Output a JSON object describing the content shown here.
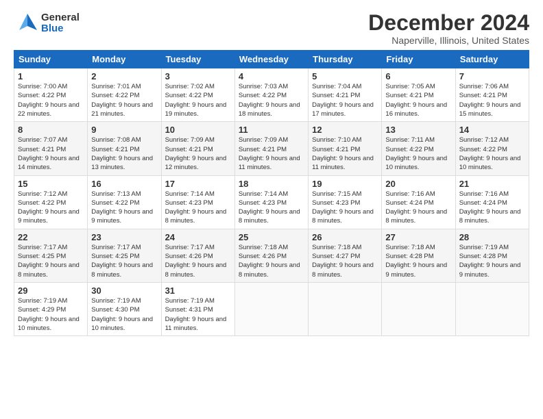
{
  "logo": {
    "general": "General",
    "blue": "Blue"
  },
  "title": "December 2024",
  "subtitle": "Naperville, Illinois, United States",
  "days_of_week": [
    "Sunday",
    "Monday",
    "Tuesday",
    "Wednesday",
    "Thursday",
    "Friday",
    "Saturday"
  ],
  "weeks": [
    [
      {
        "day": "1",
        "sunrise": "7:00 AM",
        "sunset": "4:22 PM",
        "daylight": "9 hours and 22 minutes."
      },
      {
        "day": "2",
        "sunrise": "7:01 AM",
        "sunset": "4:22 PM",
        "daylight": "9 hours and 21 minutes."
      },
      {
        "day": "3",
        "sunrise": "7:02 AM",
        "sunset": "4:22 PM",
        "daylight": "9 hours and 19 minutes."
      },
      {
        "day": "4",
        "sunrise": "7:03 AM",
        "sunset": "4:22 PM",
        "daylight": "9 hours and 18 minutes."
      },
      {
        "day": "5",
        "sunrise": "7:04 AM",
        "sunset": "4:21 PM",
        "daylight": "9 hours and 17 minutes."
      },
      {
        "day": "6",
        "sunrise": "7:05 AM",
        "sunset": "4:21 PM",
        "daylight": "9 hours and 16 minutes."
      },
      {
        "day": "7",
        "sunrise": "7:06 AM",
        "sunset": "4:21 PM",
        "daylight": "9 hours and 15 minutes."
      }
    ],
    [
      {
        "day": "8",
        "sunrise": "7:07 AM",
        "sunset": "4:21 PM",
        "daylight": "9 hours and 14 minutes."
      },
      {
        "day": "9",
        "sunrise": "7:08 AM",
        "sunset": "4:21 PM",
        "daylight": "9 hours and 13 minutes."
      },
      {
        "day": "10",
        "sunrise": "7:09 AM",
        "sunset": "4:21 PM",
        "daylight": "9 hours and 12 minutes."
      },
      {
        "day": "11",
        "sunrise": "7:09 AM",
        "sunset": "4:21 PM",
        "daylight": "9 hours and 11 minutes."
      },
      {
        "day": "12",
        "sunrise": "7:10 AM",
        "sunset": "4:21 PM",
        "daylight": "9 hours and 11 minutes."
      },
      {
        "day": "13",
        "sunrise": "7:11 AM",
        "sunset": "4:22 PM",
        "daylight": "9 hours and 10 minutes."
      },
      {
        "day": "14",
        "sunrise": "7:12 AM",
        "sunset": "4:22 PM",
        "daylight": "9 hours and 10 minutes."
      }
    ],
    [
      {
        "day": "15",
        "sunrise": "7:12 AM",
        "sunset": "4:22 PM",
        "daylight": "9 hours and 9 minutes."
      },
      {
        "day": "16",
        "sunrise": "7:13 AM",
        "sunset": "4:22 PM",
        "daylight": "9 hours and 9 minutes."
      },
      {
        "day": "17",
        "sunrise": "7:14 AM",
        "sunset": "4:23 PM",
        "daylight": "9 hours and 8 minutes."
      },
      {
        "day": "18",
        "sunrise": "7:14 AM",
        "sunset": "4:23 PM",
        "daylight": "9 hours and 8 minutes."
      },
      {
        "day": "19",
        "sunrise": "7:15 AM",
        "sunset": "4:23 PM",
        "daylight": "9 hours and 8 minutes."
      },
      {
        "day": "20",
        "sunrise": "7:16 AM",
        "sunset": "4:24 PM",
        "daylight": "9 hours and 8 minutes."
      },
      {
        "day": "21",
        "sunrise": "7:16 AM",
        "sunset": "4:24 PM",
        "daylight": "9 hours and 8 minutes."
      }
    ],
    [
      {
        "day": "22",
        "sunrise": "7:17 AM",
        "sunset": "4:25 PM",
        "daylight": "9 hours and 8 minutes."
      },
      {
        "day": "23",
        "sunrise": "7:17 AM",
        "sunset": "4:25 PM",
        "daylight": "9 hours and 8 minutes."
      },
      {
        "day": "24",
        "sunrise": "7:17 AM",
        "sunset": "4:26 PM",
        "daylight": "9 hours and 8 minutes."
      },
      {
        "day": "25",
        "sunrise": "7:18 AM",
        "sunset": "4:26 PM",
        "daylight": "9 hours and 8 minutes."
      },
      {
        "day": "26",
        "sunrise": "7:18 AM",
        "sunset": "4:27 PM",
        "daylight": "9 hours and 8 minutes."
      },
      {
        "day": "27",
        "sunrise": "7:18 AM",
        "sunset": "4:28 PM",
        "daylight": "9 hours and 9 minutes."
      },
      {
        "day": "28",
        "sunrise": "7:19 AM",
        "sunset": "4:28 PM",
        "daylight": "9 hours and 9 minutes."
      }
    ],
    [
      {
        "day": "29",
        "sunrise": "7:19 AM",
        "sunset": "4:29 PM",
        "daylight": "9 hours and 10 minutes."
      },
      {
        "day": "30",
        "sunrise": "7:19 AM",
        "sunset": "4:30 PM",
        "daylight": "9 hours and 10 minutes."
      },
      {
        "day": "31",
        "sunrise": "7:19 AM",
        "sunset": "4:31 PM",
        "daylight": "9 hours and 11 minutes."
      },
      null,
      null,
      null,
      null
    ]
  ]
}
